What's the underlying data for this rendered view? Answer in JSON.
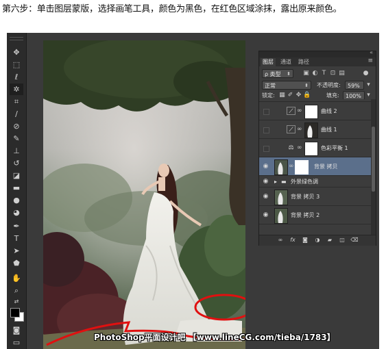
{
  "instruction": "第六步：单击图层蒙版，选择画笔工具，颜色为黑色，在红色区域涂抹，露出原来颜色。",
  "watermark": "PhotoShop平面设计吧 【www.lineCG.com/tieba/1783】",
  "toolbar": {
    "tools": [
      "move-tool",
      "marquee-tool",
      "lasso-tool",
      "magic-wand-tool",
      "crop-tool",
      "eyedropper-tool",
      "healing-brush-tool",
      "brush-tool",
      "clone-stamp-tool",
      "history-brush-tool",
      "eraser-tool",
      "gradient-tool",
      "blur-tool",
      "dodge-tool",
      "pen-tool",
      "type-tool",
      "path-selection-tool",
      "shape-tool",
      "hand-tool",
      "zoom-tool"
    ],
    "selected_tool": "magic-wand-tool",
    "foreground_color": "#000000",
    "background_color": "#ffffff"
  },
  "layers_panel": {
    "tabs": [
      "图层",
      "通道",
      "路径"
    ],
    "active_tab": "图层",
    "filter_kind": "类型",
    "blend_mode": "正常",
    "opacity_label": "不透明度:",
    "opacity_value": "59%",
    "lock_label": "锁定:",
    "fill_label": "填充:",
    "fill_value": "100%",
    "layers": [
      {
        "name": "曲线 2",
        "type": "adjustment",
        "icon": "curves-icon",
        "visible": false,
        "selected": false
      },
      {
        "name": "曲线 1",
        "type": "adjustment",
        "icon": "curves-icon",
        "visible": false,
        "selected": false
      },
      {
        "name": "色彩平衡 1",
        "type": "adjustment",
        "icon": "color-balance-icon",
        "visible": false,
        "selected": false
      },
      {
        "name": "背景 拷贝",
        "type": "image-with-mask",
        "visible": true,
        "selected": true
      },
      {
        "name": "外景绿色调",
        "type": "group",
        "visible": true,
        "selected": false
      },
      {
        "name": "背景 拷贝 3",
        "type": "image",
        "visible": true,
        "selected": false
      },
      {
        "name": "背景 拷贝 2",
        "type": "image",
        "visible": true,
        "selected": false
      }
    ],
    "bottom_icons": [
      "link-icon",
      "fx-icon",
      "add-mask-icon",
      "adjustment-icon",
      "group-icon",
      "new-layer-icon",
      "delete-icon"
    ]
  },
  "colors": {
    "annotation_red": "#e01010",
    "selected_layer": "#5b6f8b"
  }
}
